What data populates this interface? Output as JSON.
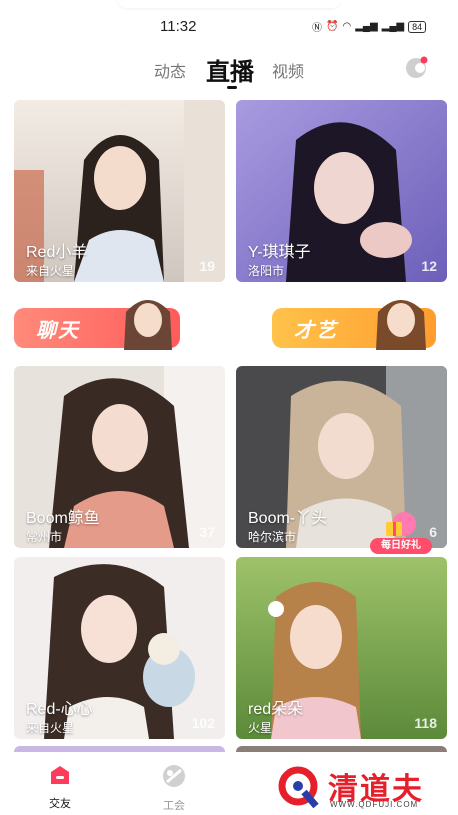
{
  "status_bar": {
    "time": "11:32",
    "battery": "84"
  },
  "tabs": [
    {
      "label": "动态",
      "active": false
    },
    {
      "label": "直播",
      "active": true
    },
    {
      "label": "视频",
      "active": false
    }
  ],
  "rooms": [
    {
      "name": "Red小羊",
      "location": "来自火星",
      "count": "19"
    },
    {
      "name": "Y-琪琪子",
      "location": "洛阳市",
      "count": "12"
    },
    {
      "name": "Boom鲸鱼",
      "location": "常州市",
      "count": "37"
    },
    {
      "name": "Boom-丫头",
      "location": "哈尔滨市",
      "count": "6"
    },
    {
      "name": "Red-心心",
      "location": "来自火星",
      "count": "102"
    },
    {
      "name": "red朵朵",
      "location": "火星",
      "count": "118"
    }
  ],
  "banners": [
    {
      "label": "聊天",
      "color": "#ff6d6a"
    },
    {
      "label": "才艺",
      "color": "#ffb13a"
    }
  ],
  "gift_badge": {
    "label": "每日好礼"
  },
  "bottom_nav": [
    {
      "label": "交友",
      "active": true,
      "icon": "home-icon"
    },
    {
      "label": "工会",
      "active": false,
      "icon": "guild-icon"
    }
  ],
  "watermark": {
    "title": "清道夫",
    "url": "WWW.QDFUJI.COM"
  },
  "colors": {
    "accent": "#ff3b5c",
    "text": "#111111",
    "muted": "#777777"
  }
}
